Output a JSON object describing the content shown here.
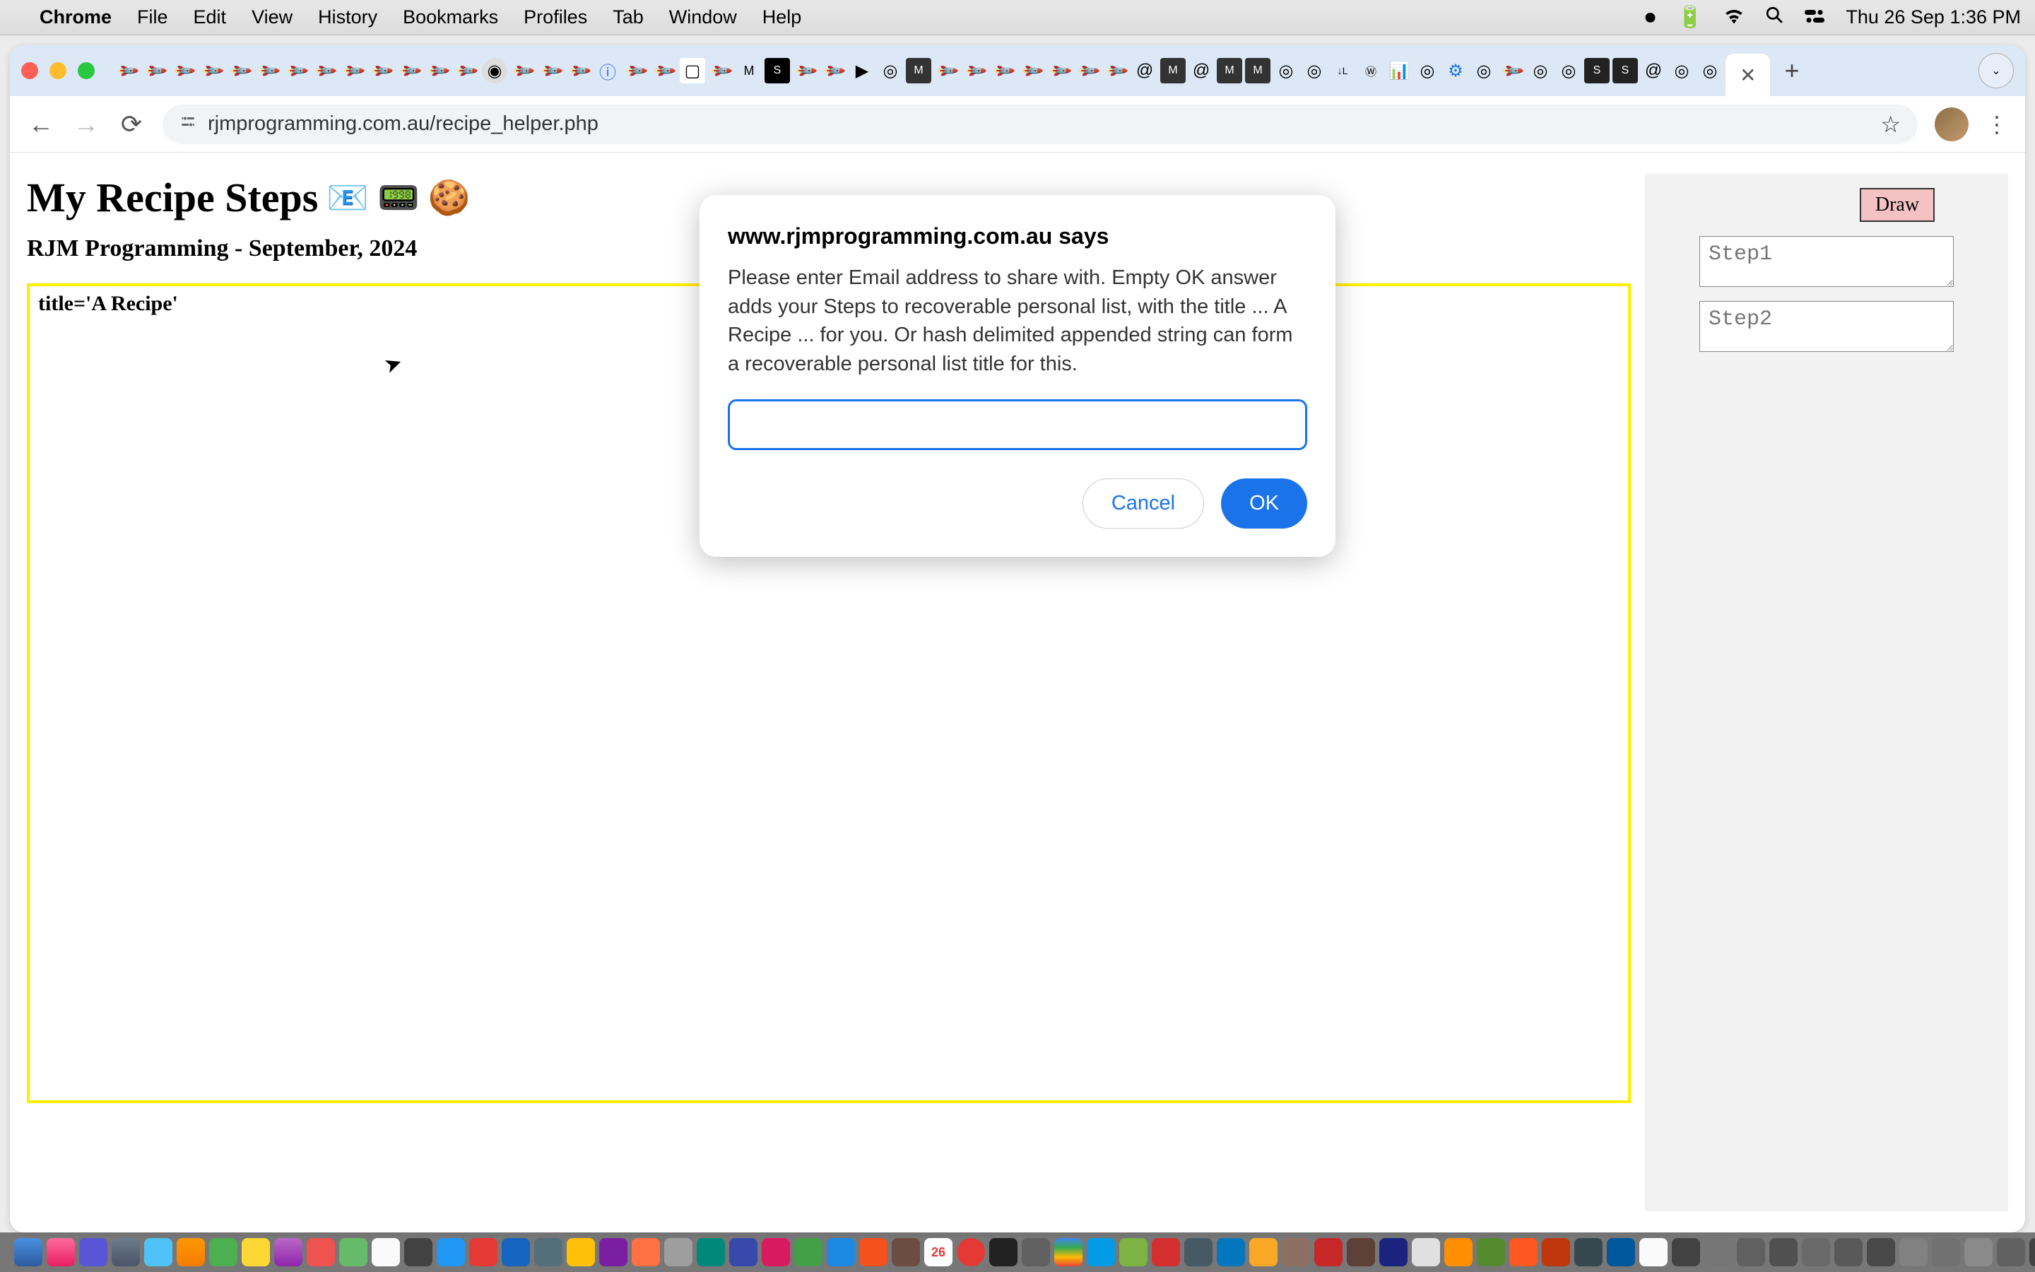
{
  "menubar": {
    "app": "Chrome",
    "items": [
      "File",
      "Edit",
      "View",
      "History",
      "Bookmarks",
      "Profiles",
      "Tab",
      "Window",
      "Help"
    ],
    "datetime": "Thu 26 Sep  1:36 PM"
  },
  "browser": {
    "url": "rjmprogramming.com.au/recipe_helper.php",
    "nav": {
      "back": "←",
      "forward": "→",
      "reload": "⟳"
    },
    "tab_close": "✕",
    "tab_new": "+",
    "dropdown": "⌄",
    "star": "☆",
    "menu": "⋮"
  },
  "page": {
    "title": "My Recipe Steps",
    "subtitle": "RJM Programming - September, 2024",
    "recipe_title": "title='A Recipe'"
  },
  "sidebar": {
    "draw_label": "Draw",
    "step1_placeholder": "Step1",
    "step2_placeholder": "Step2"
  },
  "dialog": {
    "title": "www.rjmprogramming.com.au says",
    "message": "Please enter Email address to share with. Empty OK answer adds your Steps to recoverable personal list, with the title ... A Recipe ... for you. Or hash delimited appended string can form a recoverable personal list title for this.",
    "cancel": "Cancel",
    "ok": "OK",
    "input_value": ""
  },
  "icons": {
    "email": "📧",
    "video": "📟",
    "cookie": "🍪"
  }
}
